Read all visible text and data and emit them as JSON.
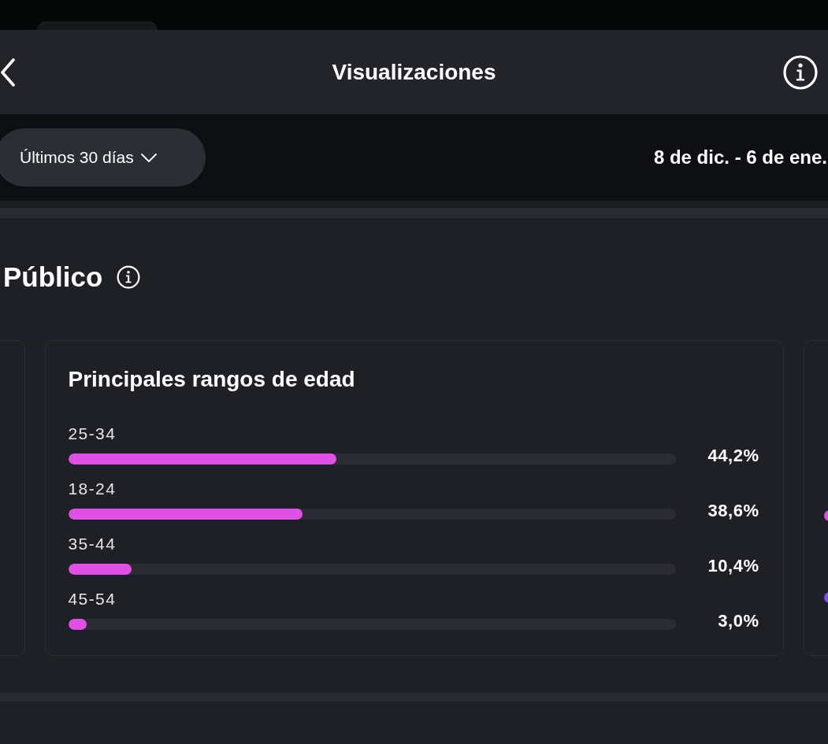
{
  "header": {
    "title": "Visualizaciones"
  },
  "filter": {
    "period": "Últimos 30 días",
    "date_range": "8 de dic. - 6 de ene."
  },
  "section": {
    "title": "Público"
  },
  "age_card": {
    "title": "Principales rangos de edad",
    "rows": [
      {
        "label": "25-34",
        "level": 0.442,
        "value": "44,2%"
      },
      {
        "label": "18-24",
        "level": 0.386,
        "value": "38,6%"
      },
      {
        "label": "35-44",
        "level": 0.104,
        "value": "10,4%"
      },
      {
        "label": "45-54",
        "level": 0.03,
        "value": "3,0%"
      }
    ]
  },
  "next_card": {
    "bars": [
      {
        "color": "#e04fe6"
      },
      {
        "color": "#7a4ef0"
      }
    ]
  }
}
